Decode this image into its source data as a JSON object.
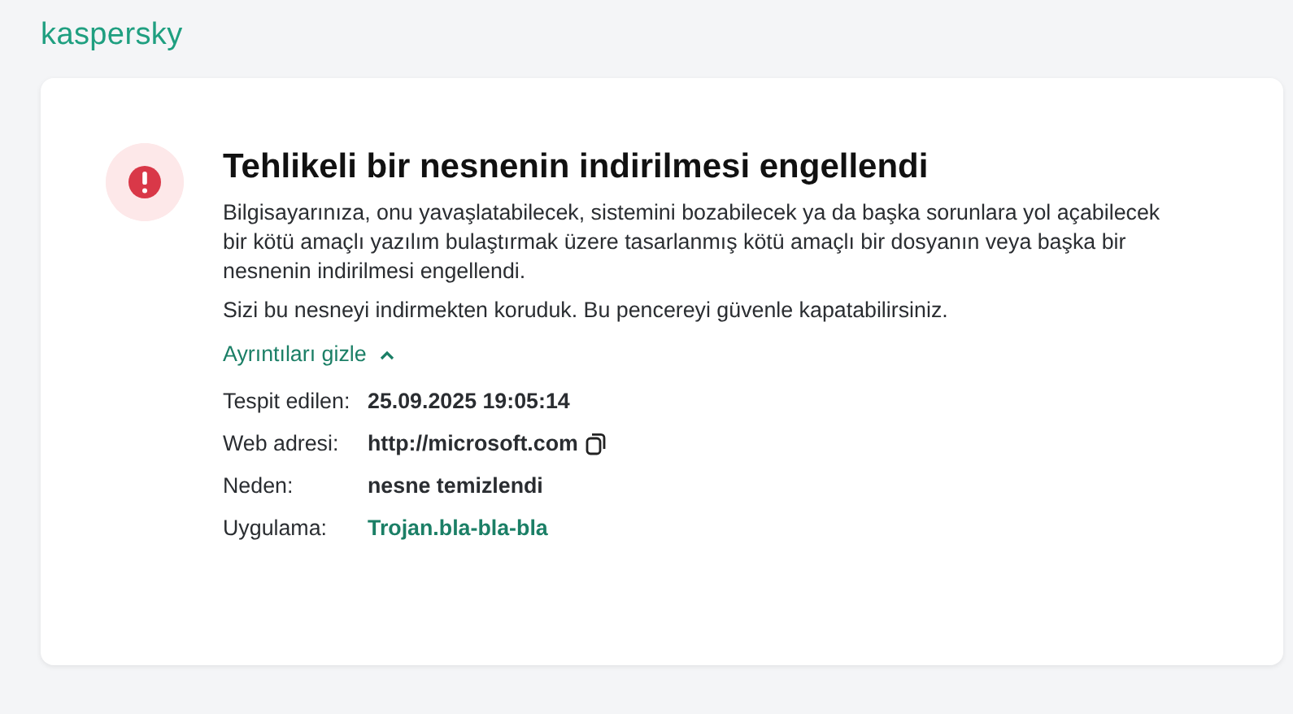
{
  "brand": "kaspersky",
  "alert": {
    "title": "Tehlikeli bir nesnenin indirilmesi engellendi",
    "paragraphs": [
      "Bilgisayarınıza, onu yavaşlatabilecek, sistemini bozabilecek ya da başka sorunlara yol açabilecek bir kötü amaçlı yazılım bulaştırmak üzere tasarlanmış kötü amaçlı bir dosyanın veya başka bir nesnenin indirilmesi engellendi.",
      "Sizi bu nesneyi indirmekten koruduk. Bu pencereyi güvenle kapatabilirsiniz."
    ],
    "details_toggle": {
      "label": "Ayrıntıları gizle",
      "expanded": true
    },
    "details": [
      {
        "label": "Tespit edilen:",
        "value": "25.09.2025 19:05:14",
        "kind": "text",
        "copyable": false
      },
      {
        "label": "Web adresi:",
        "value": "http://microsoft.com",
        "kind": "text",
        "copyable": true
      },
      {
        "label": "Neden:",
        "value": "nesne temizlendi",
        "kind": "text",
        "copyable": false
      },
      {
        "label": "Uygulama:",
        "value": "Trojan.bla-bla-bla",
        "kind": "link",
        "copyable": false
      }
    ]
  }
}
